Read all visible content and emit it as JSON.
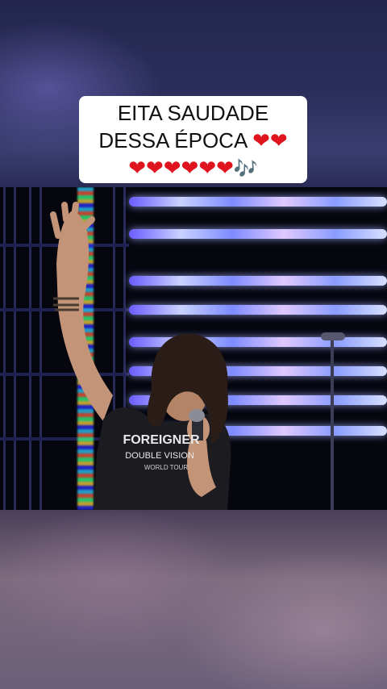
{
  "caption": {
    "line1": "EITA SAUDADE",
    "line2_text": "DESSA ÉPOCA ",
    "line2_hearts": "❤❤",
    "line3_hearts": "❤❤❤❤❤❤",
    "line3_notes": "🎶"
  },
  "video": {
    "shirt_text_top": "FOREIGNER",
    "shirt_text_mid": "DOUBLE VISION",
    "shirt_text_bottom": "WORLD TOUR"
  },
  "colors": {
    "heart": "#e0141e",
    "notes": "#3aa8ff",
    "caption_bg": "#ffffff"
  }
}
